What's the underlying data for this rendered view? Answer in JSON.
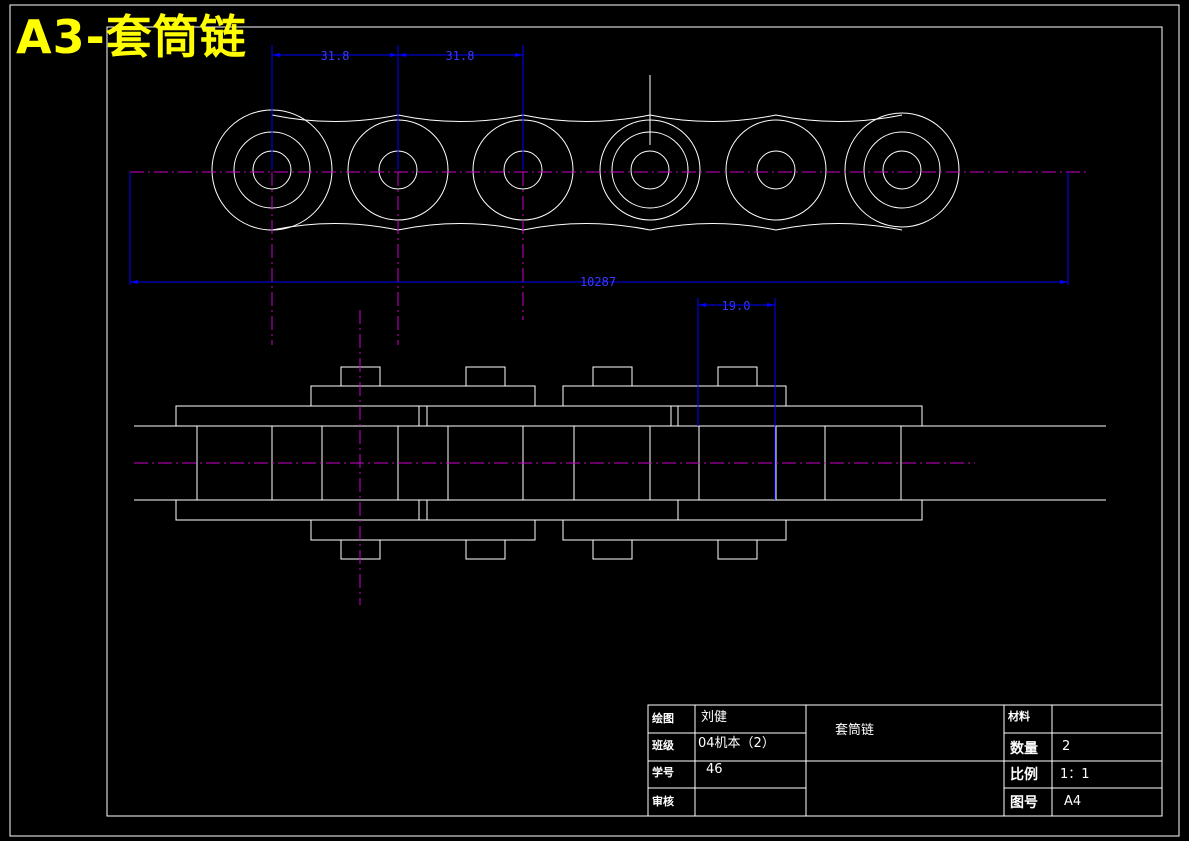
{
  "title": "A3-套筒链",
  "dimensions": {
    "pitch_left": "31.8",
    "pitch_right": "31.8",
    "overall_length": "10287",
    "inner_width": "19.0"
  },
  "title_block": {
    "drawn_by_label": "绘图",
    "drawn_by_value": "刘健",
    "class_label": "班级",
    "class_value": "04机本（2）",
    "student_no_label": "学号",
    "student_no_value": "46",
    "review_label": "审核",
    "review_value": "",
    "part_name": "套筒链",
    "material_label": "材料",
    "material_value": "",
    "quantity_label": "数量",
    "quantity_value": "2",
    "scale_label": "比例",
    "scale_value": "1：1",
    "sheet_label": "图号",
    "sheet_value": "A4"
  },
  "colors": {
    "background": "#000000",
    "outline": "#ffffff",
    "centerline": "#cc00cc",
    "dimension": "#0000ff",
    "dimension_text": "#3a3aff",
    "title": "#ffff00"
  }
}
